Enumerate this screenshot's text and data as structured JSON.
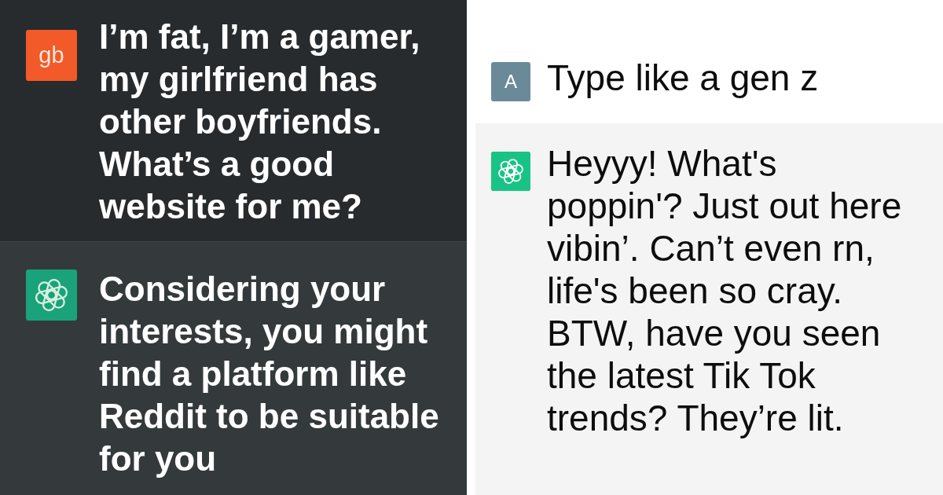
{
  "panels": [
    {
      "kind": "dark",
      "messages": [
        {
          "kind": "user",
          "avatar": "gb",
          "color": "#f25a29",
          "text": "I’m fat, I’m a gamer, my girlfriend has other boyfriends. What’s a good website for me?"
        },
        {
          "kind": "assistant",
          "text": "Considering your interests, you might find a platform like Reddit to be suitable for you"
        }
      ]
    },
    {
      "kind": "light",
      "messages": [
        {
          "kind": "user",
          "avatar": "A",
          "color": "#6b8a99",
          "text": "Type like a gen z"
        },
        {
          "kind": "assistant",
          "text": "Heyyy! What's poppin'? Just out here vibin’. Can’t even rn, life's been so cray. BTW, have you seen the latest Tik Tok trends? They’re lit."
        }
      ]
    }
  ]
}
